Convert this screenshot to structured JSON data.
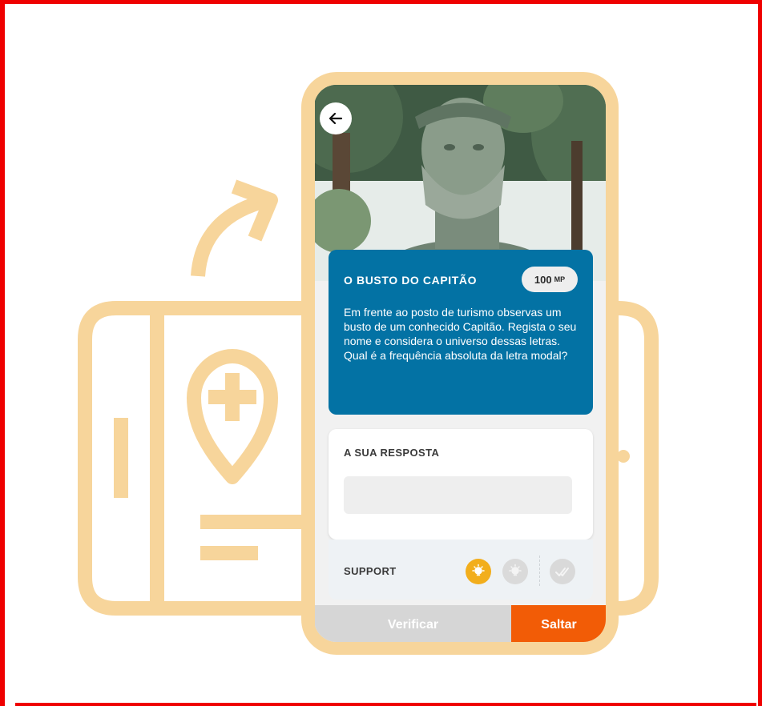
{
  "colors": {
    "frame_border": "#ef0000",
    "illustration": "#f7d59b",
    "card_blue": "#0372a4",
    "hint_active": "#f2ae1c",
    "skip_orange": "#f25c06",
    "verify_disabled": "#d6d6d6"
  },
  "header": {
    "back_icon": "arrow-left-icon"
  },
  "photo": {
    "subject": "bronze-bust-photo"
  },
  "question": {
    "title": "O BUSTO DO CAPITÃO",
    "points_value": "100",
    "points_unit": "MP",
    "text": "Em frente ao posto de turismo observas um busto de um conhecido Capitão. Regista o seu nome e considera o universo dessas letras.\nQual é a frequência absoluta da letra modal?"
  },
  "answer": {
    "label": "A SUA RESPOSTA",
    "value": "",
    "placeholder": ""
  },
  "support": {
    "label": "SUPPORT",
    "icons": [
      "lightbulb-icon",
      "lightbulb-icon",
      "double-check-icon"
    ]
  },
  "actions": {
    "verify_label": "Verificar",
    "skip_label": "Saltar"
  }
}
